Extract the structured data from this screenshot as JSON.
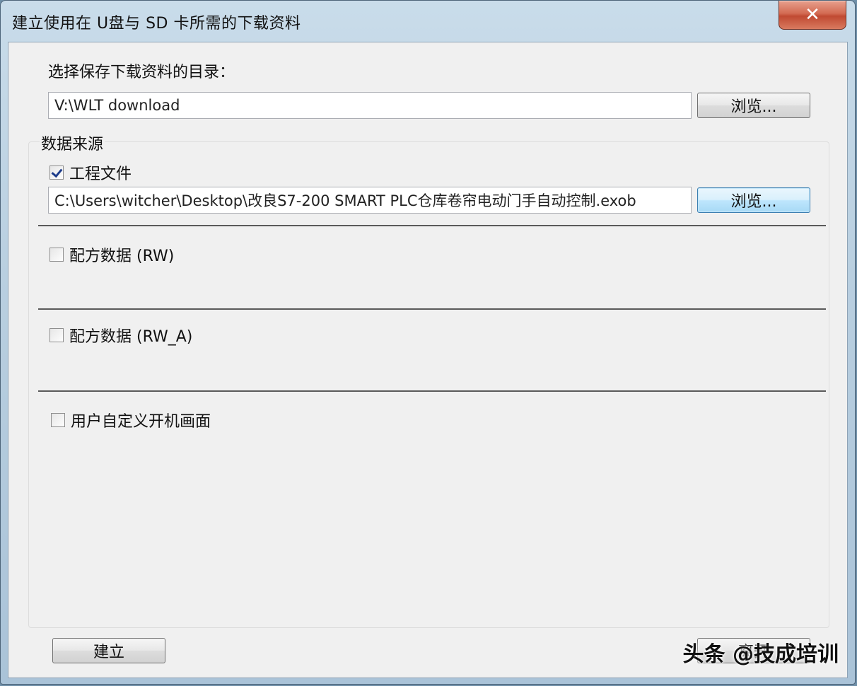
{
  "window": {
    "title": "建立使用在 U盘与 SD 卡所需的下载资料",
    "close_glyph": "✕"
  },
  "directory": {
    "label": "选择保存下载资料的目录：",
    "value": "V:\\WLT download",
    "browse_label": "浏览..."
  },
  "data_source": {
    "group_label": "数据来源",
    "project_file": {
      "label": "工程文件",
      "checked": true,
      "path": "C:\\Users\\witcher\\Desktop\\改良S7-200 SMART PLC仓库卷帘电动门手自动控制.exob",
      "browse_label": "浏览..."
    },
    "recipe_rw": {
      "label": "配方数据 (RW)",
      "checked": false
    },
    "recipe_rw_a": {
      "label": "配方数据 (RW_A)",
      "checked": false
    },
    "custom_boot_screen": {
      "label": "用户自定义开机画面",
      "checked": false
    }
  },
  "footer": {
    "create_label": "建立",
    "leave_label": "离开"
  },
  "watermark": "头条 @技成培训"
}
